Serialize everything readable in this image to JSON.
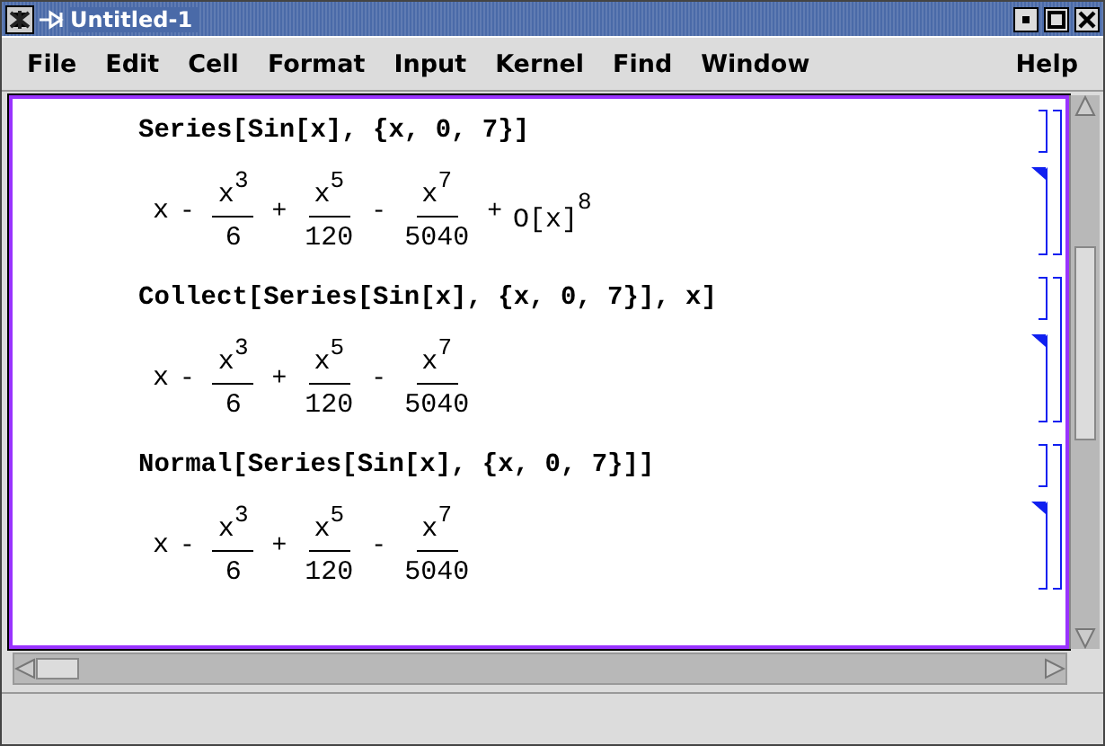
{
  "window": {
    "title": "Untitled-1"
  },
  "menu": [
    {
      "label": "File"
    },
    {
      "label": "Edit"
    },
    {
      "label": "Cell"
    },
    {
      "label": "Format"
    },
    {
      "label": "Input"
    },
    {
      "label": "Kernel"
    },
    {
      "label": "Find"
    },
    {
      "label": "Window"
    }
  ],
  "help_menu": {
    "label": "Help"
  },
  "cell_groups": [
    {
      "input": "Series[Sin[x], {x, 0, 7}]",
      "output": [
        {
          "kind": "text",
          "text": "x"
        },
        {
          "kind": "op",
          "text": "-"
        },
        {
          "kind": "fraction",
          "base": "x",
          "power": "3",
          "denominator": "6"
        },
        {
          "kind": "op",
          "text": "+"
        },
        {
          "kind": "fraction",
          "base": "x",
          "power": "5",
          "denominator": "120"
        },
        {
          "kind": "op",
          "text": "-"
        },
        {
          "kind": "fraction",
          "base": "x",
          "power": "7",
          "denominator": "5040"
        },
        {
          "kind": "op",
          "text": "+"
        },
        {
          "kind": "power",
          "base": "O[x]",
          "power": "8"
        }
      ]
    },
    {
      "input": "Collect[Series[Sin[x], {x, 0, 7}], x]",
      "output": [
        {
          "kind": "text",
          "text": "x"
        },
        {
          "kind": "op",
          "text": "-"
        },
        {
          "kind": "fraction",
          "base": "x",
          "power": "3",
          "denominator": "6"
        },
        {
          "kind": "op",
          "text": "+"
        },
        {
          "kind": "fraction",
          "base": "x",
          "power": "5",
          "denominator": "120"
        },
        {
          "kind": "op",
          "text": "-"
        },
        {
          "kind": "fraction",
          "base": "x",
          "power": "7",
          "denominator": "5040"
        }
      ]
    },
    {
      "input": "Normal[Series[Sin[x], {x, 0, 7}]]",
      "output": [
        {
          "kind": "text",
          "text": "x"
        },
        {
          "kind": "op",
          "text": "-"
        },
        {
          "kind": "fraction",
          "base": "x",
          "power": "3",
          "denominator": "6"
        },
        {
          "kind": "op",
          "text": "+"
        },
        {
          "kind": "fraction",
          "base": "x",
          "power": "5",
          "denominator": "120"
        },
        {
          "kind": "op",
          "text": "-"
        },
        {
          "kind": "fraction",
          "base": "x",
          "power": "7",
          "denominator": "5040"
        }
      ]
    }
  ]
}
